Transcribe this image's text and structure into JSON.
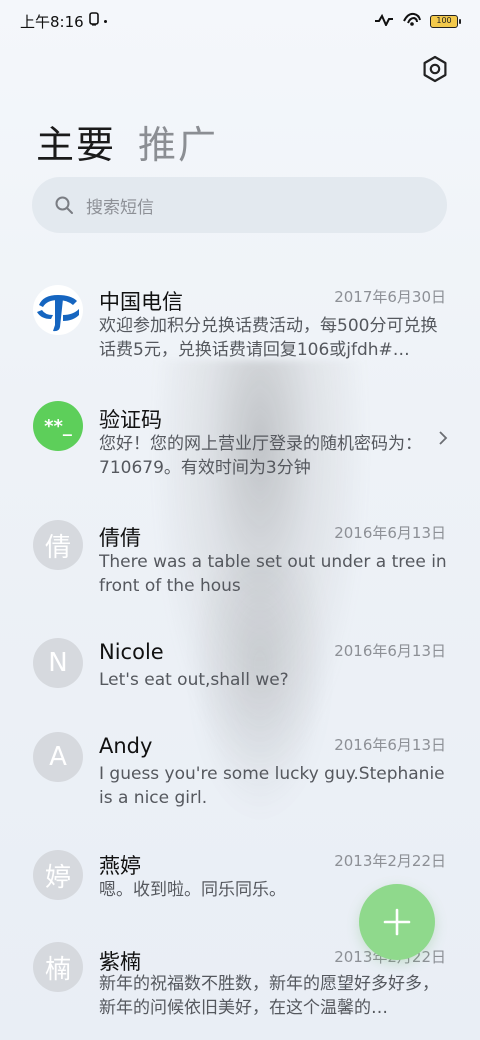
{
  "status_bar": {
    "time": "上午8:16",
    "battery": "100"
  },
  "tabs": [
    {
      "label": "主要"
    },
    {
      "label": "推广"
    }
  ],
  "search": {
    "placeholder": "搜索短信"
  },
  "conversations": [
    {
      "name": "中国电信",
      "date": "2017年6月30日",
      "preview": "欢迎参加积分兑换话费活动，每500分可兑换话费5元，兑换话费请回复106或jfdh#…",
      "avatar": "logo"
    },
    {
      "name": "验证码",
      "date": "",
      "preview": "您好！您的网上营业厅登录的随机密码为：710679。有效时间为3分钟",
      "avatar": "**_"
    },
    {
      "name": "倩倩",
      "date": "2016年6月13日",
      "preview": "There was a table set out under a tree in front of the hous",
      "avatar": "倩"
    },
    {
      "name": "Nicole",
      "date": "2016年6月13日",
      "preview": "Let's eat out,shall we?",
      "avatar": "N"
    },
    {
      "name": "Andy",
      "date": "2016年6月13日",
      "preview": "I guess you're some lucky guy.Stephanie is a nice girl.",
      "avatar": "A"
    },
    {
      "name": "燕婷",
      "date": "2013年2月22日",
      "preview": "嗯。收到啦。同乐同乐。",
      "avatar": "婷"
    },
    {
      "name": "紫楠",
      "date": "2013年2月22日",
      "preview": "新年的祝福数不胜数，新年的愿望好多好多，新年的问候依旧美好，在这个温馨的…",
      "avatar": "楠"
    }
  ],
  "fab": {
    "icon": "plus-icon"
  },
  "colors": {
    "fab": "#8fd98c",
    "verification_avatar": "#5dcf5a",
    "telecom_blue": "#1565c0"
  }
}
